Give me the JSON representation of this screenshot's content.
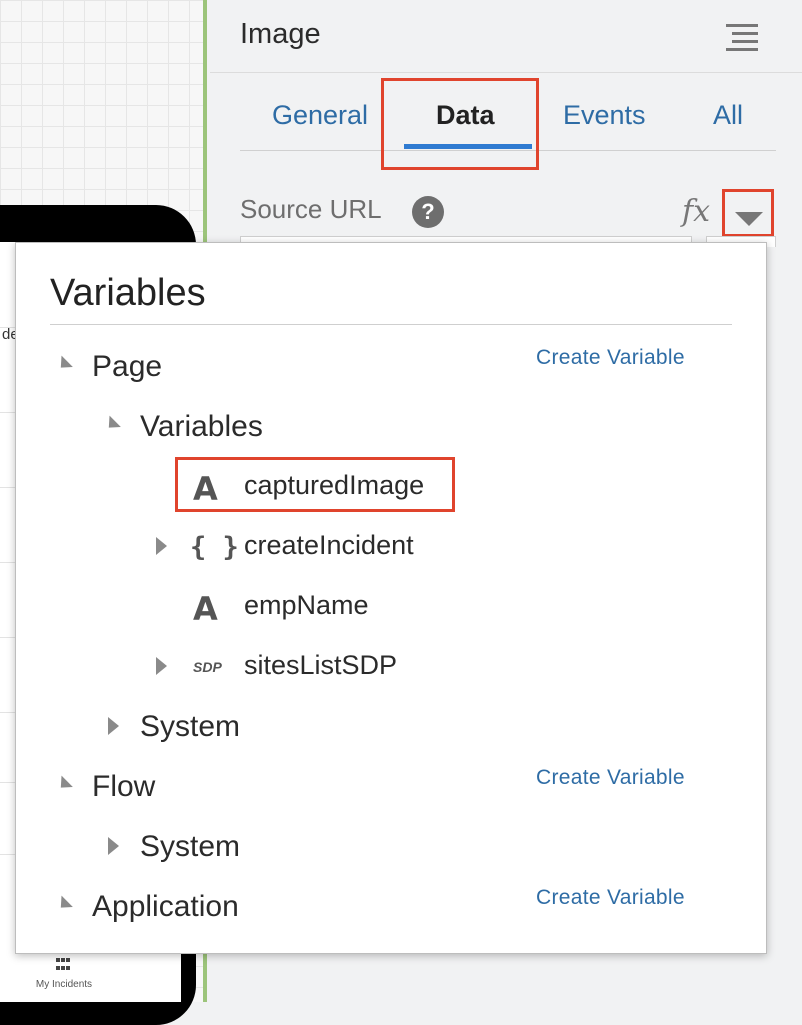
{
  "canvas": {
    "partial_text": "de",
    "tab_bar": {
      "label": "My Incidents"
    }
  },
  "panel": {
    "title": "Image",
    "tabs": [
      {
        "label": "General"
      },
      {
        "label": "Data",
        "selected": true
      },
      {
        "label": "Events"
      },
      {
        "label": "All"
      }
    ],
    "source_url": {
      "label": "Source URL",
      "help_icon": "?",
      "fx_label": "fx"
    }
  },
  "variables_popup": {
    "title": "Variables",
    "create_label": "Create Variable",
    "tree": {
      "page": "Page",
      "page_variables": "Variables",
      "items": [
        {
          "type_icon": "A",
          "name": "capturedImage",
          "highlighted": true
        },
        {
          "type_icon": "{ }",
          "name": "createIncident",
          "expandable": true
        },
        {
          "type_icon": "A",
          "name": "empName"
        },
        {
          "type_icon": "SDP",
          "name": "sitesListSDP",
          "expandable": true
        }
      ],
      "page_system": "System",
      "flow": "Flow",
      "flow_system": "System",
      "application": "Application"
    }
  },
  "colors": {
    "accent_blue": "#2f7bd1",
    "link_blue": "#2e6ca5",
    "highlight_red": "#e0442d",
    "canvas_border_green": "#9cc47a"
  }
}
